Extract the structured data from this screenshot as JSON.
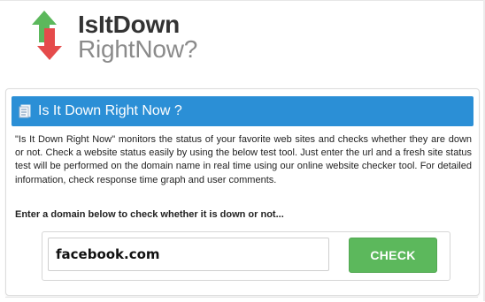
{
  "site": {
    "logo_line1": "IsItDown",
    "logo_line2": "RightNow?",
    "logo_icon": "up-down-arrows-icon",
    "colors": {
      "up_arrow": "#5cb85c",
      "down_arrow": "#e54b4b",
      "header": "#2b8fd6",
      "check_button": "#5cb85c"
    }
  },
  "panel": {
    "header_icon": "page-icon",
    "title": "Is It Down Right Now ?",
    "description": "\"Is It Down Right Now\" monitors the status of your favorite web sites and checks whether they are down or not. Check a website status easily by using the below test tool. Just enter the url and a fresh site status test will be performed on the domain name in real time using our online website checker tool. For detailed information, check response time graph and user comments.",
    "prompt": "Enter a domain below to check whether it is down or not..."
  },
  "form": {
    "domain_value": "facebook.com",
    "check_label": "CHECK"
  }
}
